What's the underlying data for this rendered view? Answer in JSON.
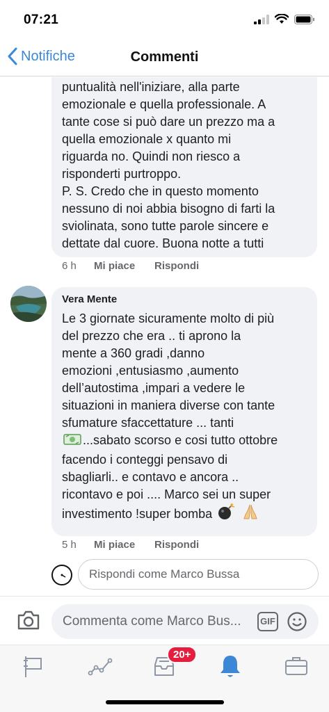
{
  "status_bar": {
    "time": "07:21"
  },
  "nav": {
    "back_label": "Notifiche",
    "title": "Commenti"
  },
  "comments": [
    {
      "author": "",
      "text": "puntualità nell'iniziare, alla parte\nemozionale e quella professionale. A\ntante cose si può dare un prezzo ma a\nquella emozionale x quanto mi\nriguarda no. Quindi non riesco a\nrisponderti purtroppo.\nP. S. Credo che in questo momento\nnessuno di noi abbia bisogno di farti la\nsviolinata, sono tutte parole sincere e\ndettate dal cuore. Buona notte a tutti",
      "time": "6 h",
      "like_label": "Mi piace",
      "reply_label": "Rispondi"
    },
    {
      "author": "Vera Mente",
      "text_part1": "Le 3 giornate sicuramente molto di più\ndel prezzo che era .. ti aprono la\nmente a 360 gradi ,danno\nemozioni ,entusiasmo ,aumento\ndell’autostima   ,impari a vedere le\nsituazioni in maniera diverse con tante\nsfumature sfaccettature ... tanti",
      "text_line8": "...sabato scorso e cosi tutto ottobre",
      "text_part2": "facendo i conteggi pensavo di\nsbagliarli.. e contavo  e ancora ..\nricontavo e poi .... Marco sei un super",
      "text_line12": "investimento !super bomba",
      "time": "5 h",
      "like_label": "Mi piace",
      "reply_label": "Rispondi"
    }
  ],
  "reply_box": {
    "placeholder": "Rispondi come Marco Bussa"
  },
  "composer": {
    "placeholder": "Commenta come Marco Bus...",
    "gif_label": "GIF"
  },
  "tab_bar": {
    "notifications_badge": "20+"
  },
  "colors": {
    "accent": "#3b88d6",
    "bubble": "#f0f2f5",
    "badge": "#e41e3f",
    "secondary_text": "#65676b"
  }
}
